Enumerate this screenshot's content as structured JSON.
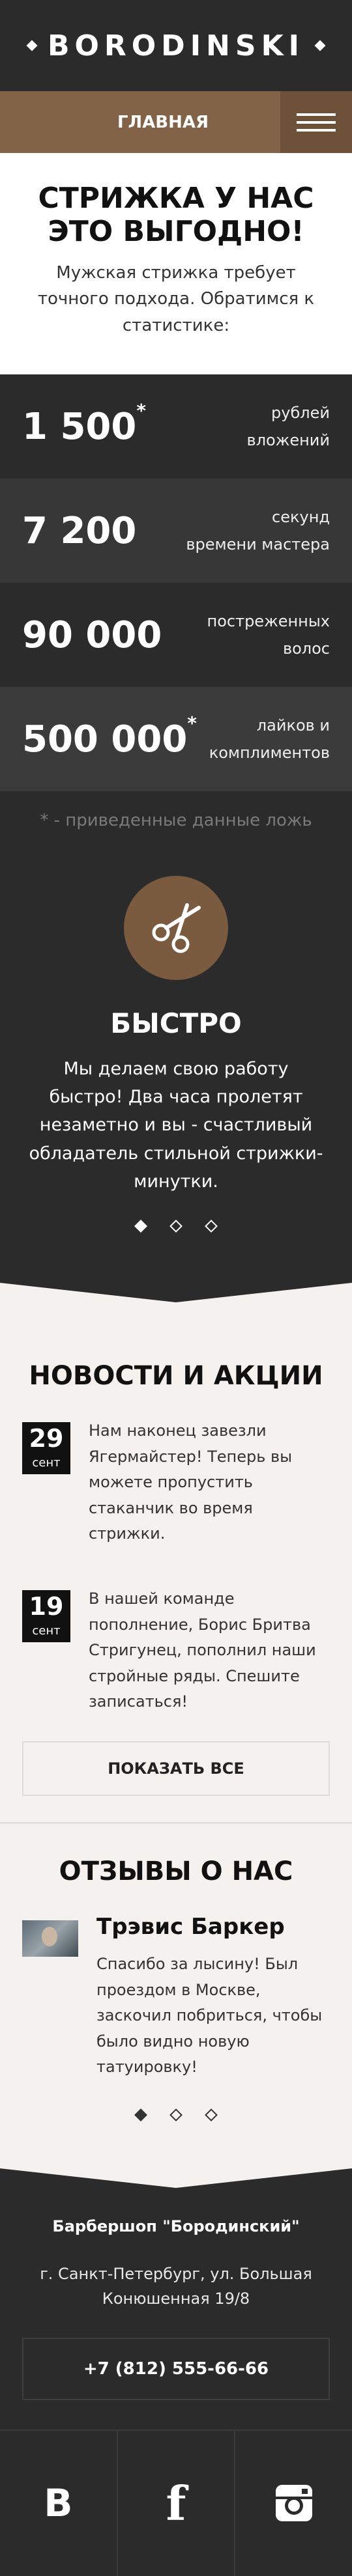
{
  "brand": {
    "name": "BORODINSKI"
  },
  "nav": {
    "home_label": "ГЛАВНАЯ"
  },
  "promo": {
    "title": "СТРИЖКА У НАС ЭТО ВЫГОДНО!",
    "text": "Мужская стрижка требует точного подхода. Обратимся к статистике:"
  },
  "stats": [
    {
      "value": "1 500",
      "mark": "*",
      "label_line1": "рублей",
      "label_line2": "вложений"
    },
    {
      "value": "7 200",
      "mark": "",
      "label_line1": "секунд",
      "label_line2": "времени мастера"
    },
    {
      "value": "90 000",
      "mark": "",
      "label_line1": "постреженных",
      "label_line2": "волос"
    },
    {
      "value": "500 000",
      "mark": "*",
      "label_line1": "лайков и",
      "label_line2": "комплиментов"
    }
  ],
  "stats_note": "* - приведенные данные ложь",
  "feature": {
    "icon": "scissors-icon",
    "title": "БЫСТРО",
    "text": "Мы делаем свою работу быстро! Два часа пролетят незаметно и вы - счастливый обладатель стильной стрижки-минутки.",
    "slide_count": 3,
    "active_slide": 1
  },
  "news": {
    "title": "НОВОСТИ И АКЦИИ",
    "items": [
      {
        "day": "29",
        "month": "сент",
        "text": "Нам наконец завезли Ягермайстер! Теперь вы можете пропустить стаканчик во время стрижки."
      },
      {
        "day": "19",
        "month": "сент",
        "text": "В нашей команде пополнение, Борис Бритва Стригунец, пополнил наши стройные ряды. Спешите записаться!"
      }
    ],
    "show_all_label": "ПОКАЗАТЬ ВСЕ"
  },
  "reviews": {
    "title": "ОТЗЫВЫ О НАС",
    "items": [
      {
        "name": "Трэвис Баркер",
        "text": "Спасибо за лысину! Был проездом в Москве, заскочил побриться, чтобы было видно новую татуировку!"
      }
    ],
    "slide_count": 3,
    "active_slide": 1
  },
  "footer": {
    "name": "Барбершоп \"Бородинский\"",
    "address": "г. Санкт-Петербург, ул. Большая Конюшенная 19/8",
    "phone": "+7 (812) 555-66-66"
  },
  "social": {
    "vk_label": "B",
    "fb_label": "f",
    "icons": [
      "vk-icon",
      "facebook-icon",
      "instagram-icon"
    ]
  },
  "colors": {
    "dark": "#2b2b2b",
    "accent": "#826347",
    "accent_dark": "#6e5139",
    "light_bg": "#f4f1ee"
  }
}
